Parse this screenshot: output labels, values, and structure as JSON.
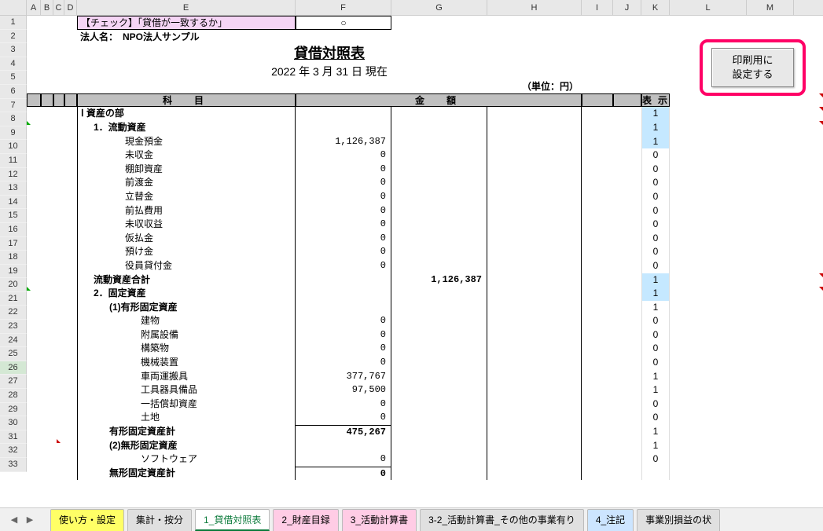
{
  "columns": [
    "A",
    "B",
    "C",
    "D",
    "E",
    "F",
    "G",
    "H",
    "I",
    "J",
    "K",
    "L",
    "M"
  ],
  "row_numbers": [
    1,
    2,
    3,
    4,
    5,
    6,
    7,
    8,
    9,
    10,
    11,
    12,
    13,
    14,
    15,
    16,
    17,
    18,
    19,
    20,
    21,
    22,
    23,
    24,
    25,
    26,
    27,
    28,
    29,
    30,
    31,
    32,
    33
  ],
  "check_label": "【チェック】「貸借が一致するか」",
  "check_mark": "○",
  "corp_label": "法人名：",
  "corp_name": "NPO法人サンプル",
  "title": "貸借対照表",
  "date_line": "2022 年 3 月 31 日 現在",
  "unit": "（単位：円）",
  "hdr_subject": "科　目",
  "hdr_amount": "金　額",
  "display_hdr": "表示",
  "sections": {
    "assets": "Ⅰ 資産の部",
    "current_assets": "1．流動資産",
    "fixed_assets": "2．固定資産",
    "tangible": "(1)有形固定資産",
    "intangible": "(2)無形固定資産"
  },
  "current_items": [
    {
      "name": "現金預金",
      "val": "1,126,387",
      "disp": "1",
      "hl": true
    },
    {
      "name": "未収金",
      "val": "0",
      "disp": "0"
    },
    {
      "name": "棚卸資産",
      "val": "0",
      "disp": "0"
    },
    {
      "name": "前渡金",
      "val": "0",
      "disp": "0"
    },
    {
      "name": "立替金",
      "val": "0",
      "disp": "0"
    },
    {
      "name": "前払費用",
      "val": "0",
      "disp": "0"
    },
    {
      "name": "未収収益",
      "val": "0",
      "disp": "0"
    },
    {
      "name": "仮払金",
      "val": "0",
      "disp": "0"
    },
    {
      "name": "預け金",
      "val": "0",
      "disp": "0"
    },
    {
      "name": "役員貸付金",
      "val": "0",
      "disp": "0"
    }
  ],
  "current_total": {
    "name": "流動資産合計",
    "val": "1,126,387",
    "disp": "1"
  },
  "fixed_disp": "1",
  "tangible_disp": "1",
  "tangible_items": [
    {
      "name": "建物",
      "val": "0",
      "disp": "0"
    },
    {
      "name": "附属設備",
      "val": "0",
      "disp": "0"
    },
    {
      "name": "構築物",
      "val": "0",
      "disp": "0"
    },
    {
      "name": "機械装置",
      "val": "0",
      "disp": "0"
    },
    {
      "name": "車両運搬具",
      "val": "377,767",
      "disp": "1"
    },
    {
      "name": "工具器具備品",
      "val": "97,500",
      "disp": "1"
    },
    {
      "name": "一括償却資産",
      "val": "0",
      "disp": "0"
    },
    {
      "name": "土地",
      "val": "0",
      "disp": "0"
    }
  ],
  "tangible_total": {
    "name": "有形固定資産計",
    "val": "475,267",
    "disp": "1"
  },
  "intangible_disp": "1",
  "intangible_items": [
    {
      "name": "ソフトウェア",
      "val": "0",
      "disp": "0"
    }
  ],
  "intangible_total_name": "無形固定資産計",
  "intangible_total_val": "0",
  "print_btn": "印刷用に\n設定する",
  "tabs": [
    {
      "label": "使い方・設定",
      "cls": "yellow"
    },
    {
      "label": "集計・按分"
    },
    {
      "label": "1_貸借対照表",
      "active": true
    },
    {
      "label": "2_財産目録",
      "cls": "pink"
    },
    {
      "label": "3_活動計算書",
      "cls": "pink"
    },
    {
      "label": "3-2_活動計算書_その他の事業有り"
    },
    {
      "label": "4_注記",
      "cls": "blue"
    },
    {
      "label": "事業別損益の状"
    }
  ]
}
